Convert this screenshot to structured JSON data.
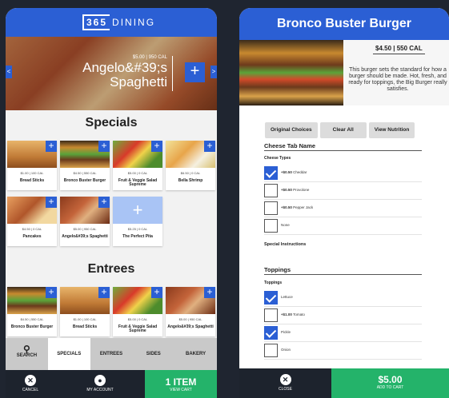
{
  "brand": {
    "box": "365",
    "text": "DINING"
  },
  "hero": {
    "price_line": "$5.00 | 950 CAL",
    "title": "Angelo&#39;s Spaghetti",
    "add": "+",
    "prev": "<",
    "next": ">"
  },
  "specials": {
    "title": "Specials",
    "items": [
      {
        "meta": "$1.00 | 100 CAL",
        "name": "Bread Sticks"
      },
      {
        "meta": "$4.50 | 550 CAL",
        "name": "Bronco Buster Burger"
      },
      {
        "meta": "$5.00 | 0 CAL",
        "name": "Fruit & Veggie Salad Supreme"
      },
      {
        "meta": "$6.50 | 0 CAL",
        "name": "Bella Shrimp"
      },
      {
        "meta": "$4.50 | 0 CAL",
        "name": "Pancakes"
      },
      {
        "meta": "$5.00 | 950 CAL",
        "name": "Angelo&#39;s Spaghetti"
      },
      {
        "meta": "$5.25 | 0 CAL",
        "name": "The Perfect Pita"
      }
    ]
  },
  "entrees": {
    "title": "Entrees",
    "items": [
      {
        "meta": "$4.50 | 550 CAL",
        "name": "Bronco Buster Burger"
      },
      {
        "meta": "$1.00 | 100 CAL",
        "name": "Bread Sticks"
      },
      {
        "meta": "$5.00 | 0 CAL",
        "name": "Fruit & Veggie Salad Supreme"
      },
      {
        "meta": "$5.00 | 950 CAL",
        "name": "Angelo&#39;s Spaghetti"
      }
    ]
  },
  "tabs": {
    "search": "SEARCH",
    "specials": "SPECIALS",
    "entrees": "ENTREES",
    "sides": "SIDES",
    "bakery": "BAKERY"
  },
  "left_bottom": {
    "cancel": "CANCEL",
    "account": "MY ACCOUNT",
    "cart_count": "1 ITEM",
    "view_cart": "VIEW CART"
  },
  "detail": {
    "title": "Bronco Buster Burger",
    "price_line": "$4.50 | 550 CAL",
    "description": "This burger sets the standard for how a burger should be made. Hot, fresh, and ready for toppings, the Big Burger really satisfies.",
    "buttons": {
      "original": "Original Choices",
      "clear": "Clear All",
      "nutrition": "View Nutrition"
    },
    "cheese_tab": "Cheese Tab Name",
    "cheese_sub": "Cheese Types",
    "cheese_options": [
      {
        "price": "+$0.50",
        "label": "Cheddar",
        "checked": true
      },
      {
        "price": "+$0.50",
        "label": "Provolone",
        "checked": false
      },
      {
        "price": "+$0.50",
        "label": "Pepper Jack",
        "checked": false
      },
      {
        "price": "",
        "label": "None",
        "checked": false
      }
    ],
    "special_instructions": "Special Instructions",
    "toppings_tab": "Toppings",
    "toppings_sub": "Toppings",
    "topping_options": [
      {
        "price": "",
        "label": "Lettuce",
        "checked": true
      },
      {
        "price": "+$1.00",
        "label": "Tomato",
        "checked": false
      },
      {
        "price": "",
        "label": "Pickle",
        "checked": true
      },
      {
        "price": "",
        "label": "Onion",
        "checked": false
      }
    ],
    "close": "CLOSE",
    "total": "$5.00",
    "add_to_cart": "ADD TO CART"
  },
  "colors": {
    "accent": "#2b5fd4",
    "cart_green": "#24b36a",
    "dark": "#1d232d"
  }
}
